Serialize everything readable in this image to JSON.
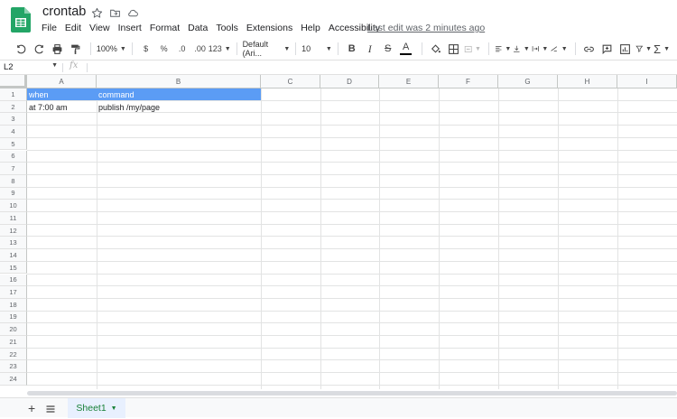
{
  "doc": {
    "title": "crontab",
    "last_edit": "Last edit was 2 minutes ago",
    "icons": [
      "star-icon",
      "move-to-folder-icon",
      "cloud-status-icon"
    ]
  },
  "menu": [
    "File",
    "Edit",
    "View",
    "Insert",
    "Format",
    "Data",
    "Tools",
    "Extensions",
    "Help",
    "Accessibility"
  ],
  "toolbar": {
    "zoom": "100%",
    "currency": "$",
    "percent": "%",
    "decrease_decimal": ".0",
    "increase_decimal": ".00",
    "more_formats": "123",
    "font": "Default (Ari...",
    "font_size": "10",
    "bold": "B",
    "italic": "I",
    "strike": "S",
    "text_color": "A",
    "text_color_value": "#000000"
  },
  "formula_bar": {
    "cell_ref": "L2",
    "fx": "fx",
    "value": ""
  },
  "columns": [
    "A",
    "B",
    "C",
    "D",
    "E",
    "F",
    "G",
    "H",
    "I"
  ],
  "rows": [
    "1",
    "2",
    "3",
    "4",
    "5",
    "6",
    "7",
    "8",
    "9",
    "10",
    "11",
    "12",
    "13",
    "14",
    "15",
    "16",
    "17",
    "18",
    "19",
    "20",
    "21",
    "22",
    "23",
    "24"
  ],
  "cells": {
    "A1": "when",
    "B1": "command",
    "A2": "at 7:00 am",
    "B2": "publish /my/page"
  },
  "header_fill": "#5b9cf5",
  "sheets": [
    {
      "name": "Sheet1",
      "active": true
    }
  ],
  "accent": "#188038"
}
